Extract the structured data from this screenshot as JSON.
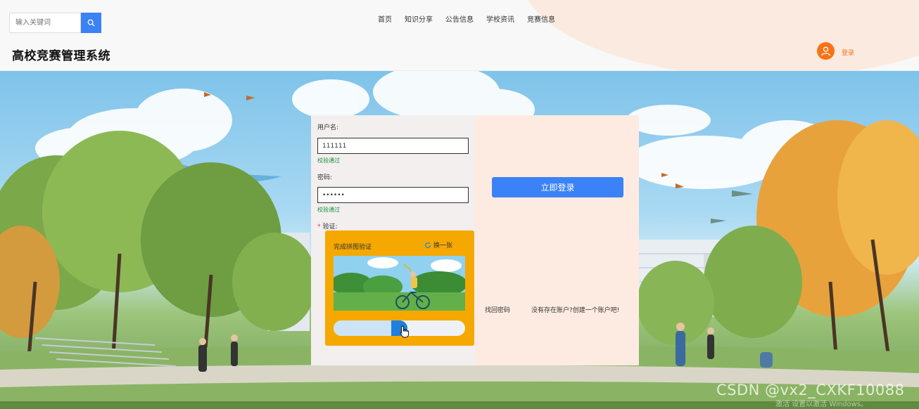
{
  "header": {
    "search": {
      "placeholder": "输入关键词"
    },
    "nav": [
      "首页",
      "知识分享",
      "公告信息",
      "学校资讯",
      "竞赛信息"
    ],
    "site_title": "高校竞赛管理系统",
    "login_link": "登录",
    "colors": {
      "accent": "#3b82f6",
      "user": "#f97316"
    }
  },
  "login_form": {
    "username_label": "用户名:",
    "username_value": "111111",
    "username_status": "校验通过",
    "password_label": "密码:",
    "password_value": "111111",
    "password_status": "校验通过",
    "captcha_label": "验证:",
    "captcha_required_mark": "*",
    "captcha": {
      "title": "完成拼图验证",
      "refresh_label": "换一张",
      "slider_progress": 0.5
    },
    "login_button": "立即登录",
    "forgot_password": "找回密码",
    "register": "没有存在账户?创建一个账户吧!"
  },
  "overlay": {
    "watermark": "CSDN @vx2_CXKF10088",
    "activate": "激活 设置以激活 Windows。"
  }
}
